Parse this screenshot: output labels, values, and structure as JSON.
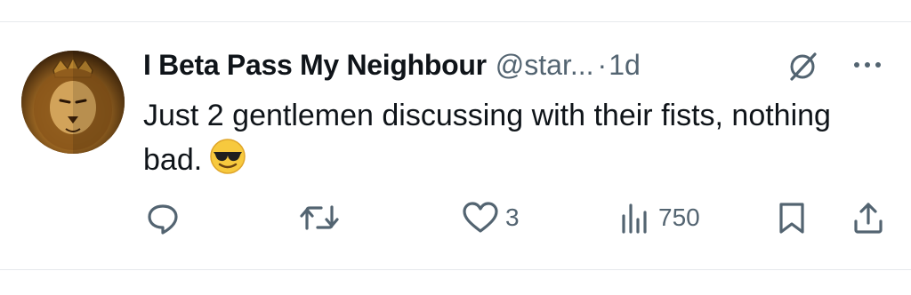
{
  "tweet": {
    "display_name": "I Beta Pass My Neighbour",
    "handle": "@star...",
    "separator": "·",
    "time": "1d",
    "text": "Just 2 gentlemen discussing with their fists, nothing bad.",
    "emoji": "smiling-face-with-sunglasses",
    "actions": {
      "reply_count": "",
      "retweet_count": "",
      "like_count": "3",
      "views_count": "750"
    },
    "icons": {
      "avatar": "lion-with-crown",
      "grok": "grok-icon",
      "more": "more-icon",
      "reply": "reply-icon",
      "retweet": "retweet-icon",
      "like": "heart-icon",
      "views": "views-icon",
      "bookmark": "bookmark-icon",
      "share": "share-icon"
    },
    "colors": {
      "text": "#0f1419",
      "secondary": "#536471",
      "divider": "#e6e9ec"
    }
  }
}
